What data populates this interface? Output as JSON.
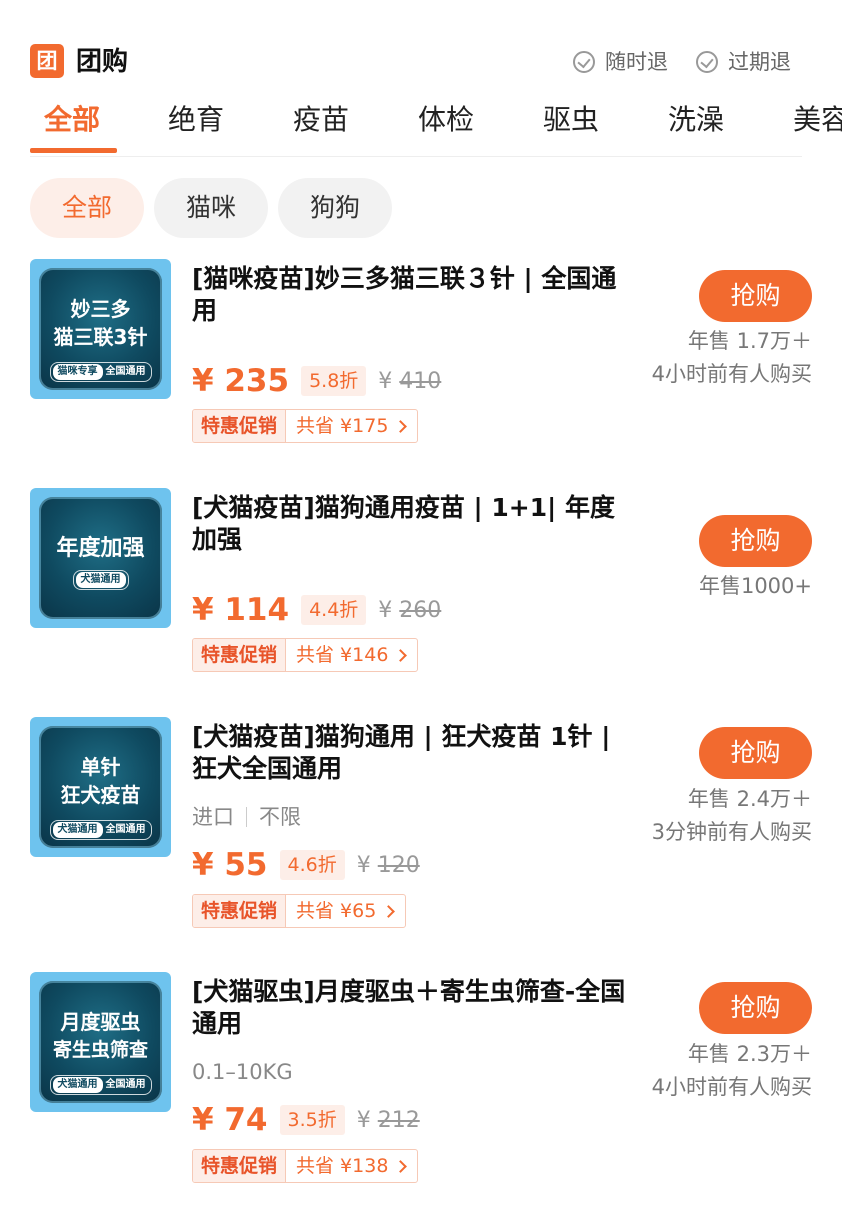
{
  "header": {
    "badge": "团",
    "title": "团购",
    "guarantees": [
      "随时退",
      "过期退"
    ]
  },
  "tabs": [
    "全部",
    "绝育",
    "疫苗",
    "体检",
    "驱虫",
    "洗澡",
    "美容"
  ],
  "filters": [
    "全部",
    "猫咪",
    "狗狗"
  ],
  "promo_label": "特惠促销",
  "buy_label": "抢购",
  "products": [
    {
      "thumb_lines": [
        "妙三多",
        "猫三联3针"
      ],
      "thumb_tags": [
        "猫咪专享",
        "全国通用"
      ],
      "title": "[猫咪疫苗]妙三多猫三联３针 | 全国通用",
      "spec": "",
      "price": "¥ 235",
      "discount": "5.8折",
      "original_price": "410",
      "savings": "共省 ¥175",
      "sales": "年售 1.7万＋",
      "recent": "4小时前有人购买"
    },
    {
      "thumb_lines": [
        "年度加强"
      ],
      "thumb_tags": [
        "犬猫通用"
      ],
      "title": "[犬猫疫苗]猫狗通用疫苗 | 1+1| 年度加强",
      "spec": "",
      "price": "¥ 114",
      "discount": "4.4折",
      "original_price": "260",
      "savings": "共省 ¥146",
      "sales": "年售1000+",
      "recent": ""
    },
    {
      "thumb_lines": [
        "单针",
        "狂犬疫苗"
      ],
      "thumb_tags": [
        "犬猫通用",
        "全国通用"
      ],
      "title": "[犬猫疫苗]猫狗通用 | 狂犬疫苗 1针 | 狂犬全国通用",
      "spec": [
        "进口",
        "不限"
      ],
      "price": "¥ 55",
      "discount": "4.6折",
      "original_price": "120",
      "savings": "共省 ¥65",
      "sales": "年售 2.4万＋",
      "recent": "3分钟前有人购买"
    },
    {
      "thumb_lines": [
        "月度驱虫",
        "寄生虫筛查"
      ],
      "thumb_tags": [
        "犬猫通用",
        "全国通用"
      ],
      "title": "[犬猫驱虫]月度驱虫＋寄生虫筛查-全国通用",
      "spec": "0.1–10KG",
      "price": "¥ 74",
      "discount": "3.5折",
      "original_price": "212",
      "savings": "共省 ¥138",
      "sales": "年售 2.3万＋",
      "recent": "4小时前有人购买"
    }
  ]
}
